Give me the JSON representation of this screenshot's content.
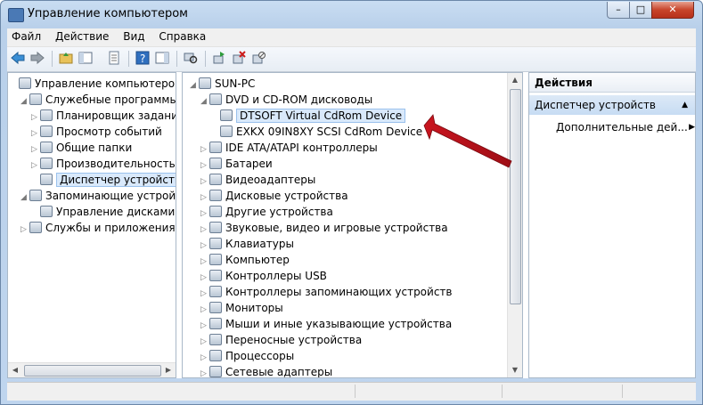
{
  "window": {
    "title": "Управление компьютером",
    "controls": {
      "minimize": "–",
      "maximize": "□",
      "close": "✕"
    }
  },
  "menu": [
    "Файл",
    "Действие",
    "Вид",
    "Справка"
  ],
  "toolbar": {
    "back_icon": "back-arrow-icon",
    "forward_icon": "forward-arrow-icon"
  },
  "left_tree": [
    {
      "label": "Управление компьютером (л",
      "icon": "computer-management-icon",
      "indent": 0,
      "arrow": ""
    },
    {
      "label": "Служебные программы",
      "icon": "tools-icon",
      "indent": 1,
      "arrow": "◢"
    },
    {
      "label": "Планировщик заданий",
      "icon": "clock-icon",
      "indent": 2,
      "arrow": "▷"
    },
    {
      "label": "Просмотр событий",
      "icon": "event-viewer-icon",
      "indent": 2,
      "arrow": "▷"
    },
    {
      "label": "Общие папки",
      "icon": "shared-folder-icon",
      "indent": 2,
      "arrow": "▷"
    },
    {
      "label": "Производительность",
      "icon": "performance-icon",
      "indent": 2,
      "arrow": "▷"
    },
    {
      "label": "Диспетчер устройств",
      "icon": "device-manager-icon",
      "indent": 2,
      "arrow": "",
      "selected": true
    },
    {
      "label": "Запоминающие устройст",
      "icon": "storage-icon",
      "indent": 1,
      "arrow": "◢"
    },
    {
      "label": "Управление дисками",
      "icon": "disk-management-icon",
      "indent": 2,
      "arrow": ""
    },
    {
      "label": "Службы и приложения",
      "icon": "services-icon",
      "indent": 1,
      "arrow": "▷"
    }
  ],
  "device_tree": [
    {
      "label": "SUN-PC",
      "icon": "computer-icon",
      "indent": 0,
      "arrow": "◢"
    },
    {
      "label": "DVD и CD-ROM дисководы",
      "icon": "dvd-drive-icon",
      "indent": 1,
      "arrow": "◢"
    },
    {
      "label": "DTSOFT Virtual CdRom Device",
      "icon": "cdrom-icon",
      "indent": 2,
      "arrow": "",
      "selected": true
    },
    {
      "label": "EXKX 09IN8XY SCSI CdRom Device",
      "icon": "cdrom-icon",
      "indent": 2,
      "arrow": ""
    },
    {
      "label": "IDE ATA/ATAPI контроллеры",
      "icon": "ide-controller-icon",
      "indent": 1,
      "arrow": "▷"
    },
    {
      "label": "Батареи",
      "icon": "battery-icon",
      "indent": 1,
      "arrow": "▷"
    },
    {
      "label": "Видеоадаптеры",
      "icon": "display-adapter-icon",
      "indent": 1,
      "arrow": "▷"
    },
    {
      "label": "Дисковые устройства",
      "icon": "disk-drive-icon",
      "indent": 1,
      "arrow": "▷"
    },
    {
      "label": "Другие устройства",
      "icon": "other-devices-icon",
      "indent": 1,
      "arrow": "▷"
    },
    {
      "label": "Звуковые, видео и игровые устройства",
      "icon": "sound-icon",
      "indent": 1,
      "arrow": "▷"
    },
    {
      "label": "Клавиатуры",
      "icon": "keyboard-icon",
      "indent": 1,
      "arrow": "▷"
    },
    {
      "label": "Компьютер",
      "icon": "computer-icon",
      "indent": 1,
      "arrow": "▷"
    },
    {
      "label": "Контроллеры USB",
      "icon": "usb-icon",
      "indent": 1,
      "arrow": "▷"
    },
    {
      "label": "Контроллеры запоминающих устройств",
      "icon": "storage-controller-icon",
      "indent": 1,
      "arrow": "▷"
    },
    {
      "label": "Мониторы",
      "icon": "monitor-icon",
      "indent": 1,
      "arrow": "▷"
    },
    {
      "label": "Мыши и иные указывающие устройства",
      "icon": "mouse-icon",
      "indent": 1,
      "arrow": "▷"
    },
    {
      "label": "Переносные устройства",
      "icon": "portable-device-icon",
      "indent": 1,
      "arrow": "▷"
    },
    {
      "label": "Процессоры",
      "icon": "processor-icon",
      "indent": 1,
      "arrow": "▷"
    },
    {
      "label": "Сетевые адаптеры",
      "icon": "network-adapter-icon",
      "indent": 1,
      "arrow": "▷"
    }
  ],
  "actions": {
    "header": "Действия",
    "section": "Диспетчер устройств",
    "section_arrow": "▲",
    "item": "Дополнительные дей...",
    "item_arrow": "▶"
  },
  "colors": {
    "annotation_arrow": "#b8141c",
    "selection": "#d9e9fb"
  }
}
